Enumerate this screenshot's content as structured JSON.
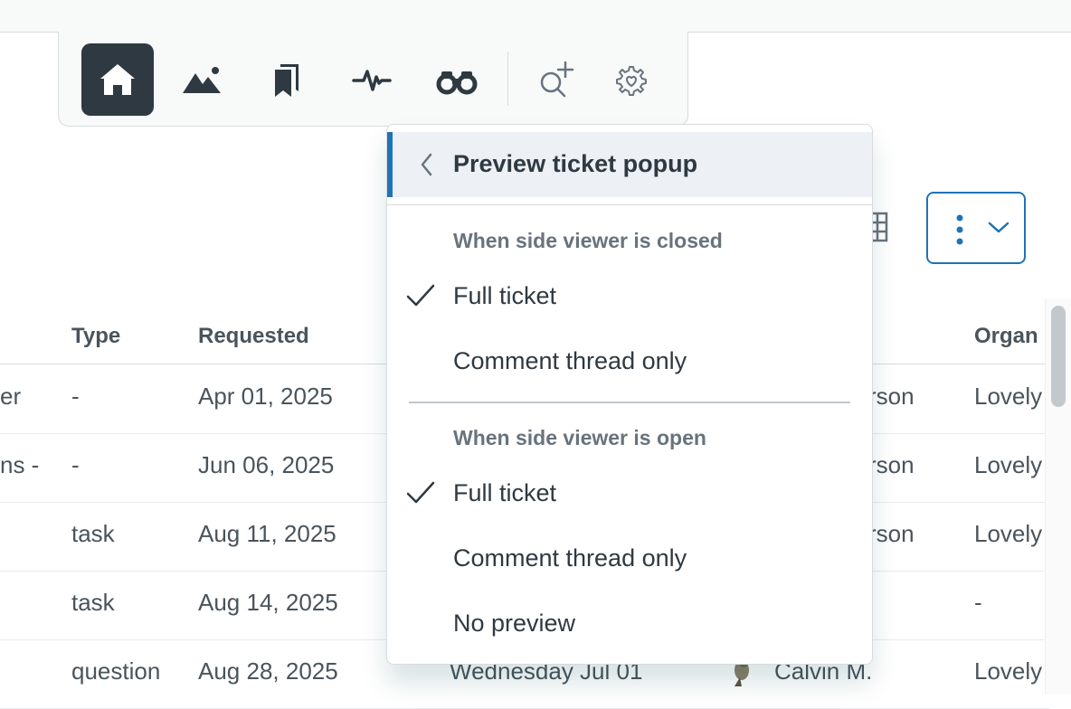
{
  "nav": {
    "items": [
      {
        "icon": "home-icon",
        "active": true
      },
      {
        "icon": "landscape-icon",
        "active": false
      },
      {
        "icon": "bookmarks-icon",
        "active": false
      },
      {
        "icon": "activity-icon",
        "active": false
      },
      {
        "icon": "binoculars-icon",
        "active": false
      },
      {
        "icon": "search-add-icon",
        "active": false
      },
      {
        "icon": "gear-heart-icon",
        "active": false
      }
    ]
  },
  "table": {
    "columns": [
      "Type",
      "Requested",
      "Organ"
    ],
    "rows": [
      {
        "subject": "er",
        "type": "-",
        "requested": "Apr 01, 2025",
        "requester": "rson",
        "org": "Lovely"
      },
      {
        "subject": "ns -",
        "type": "-",
        "requested": "Jun 06, 2025",
        "requester": "rson",
        "org": "Lovely"
      },
      {
        "subject": "",
        "type": "task",
        "requested": "Aug 11, 2025",
        "requester": "rson",
        "org": "Lovely"
      },
      {
        "subject": "",
        "type": "task",
        "requested": "Aug 14, 2025",
        "requester": "",
        "org": "-"
      },
      {
        "subject": "",
        "type": "question",
        "requested": "Aug 28, 2025",
        "updated": "Wednesday Jul 01",
        "requester": "Calvin M.",
        "org": "Lovely"
      }
    ]
  },
  "menu": {
    "title": "Preview ticket popup",
    "group_closed": {
      "label": "When side viewer is closed",
      "options": [
        {
          "label": "Full ticket",
          "checked": true
        },
        {
          "label": "Comment thread only",
          "checked": false
        }
      ]
    },
    "group_open": {
      "label": "When side viewer is open",
      "options": [
        {
          "label": "Full ticket",
          "checked": true
        },
        {
          "label": "Comment thread only",
          "checked": false
        },
        {
          "label": "No preview",
          "checked": false
        }
      ]
    }
  },
  "colors": {
    "accent": "#1f73b7",
    "nav_active": "#2f3941"
  }
}
